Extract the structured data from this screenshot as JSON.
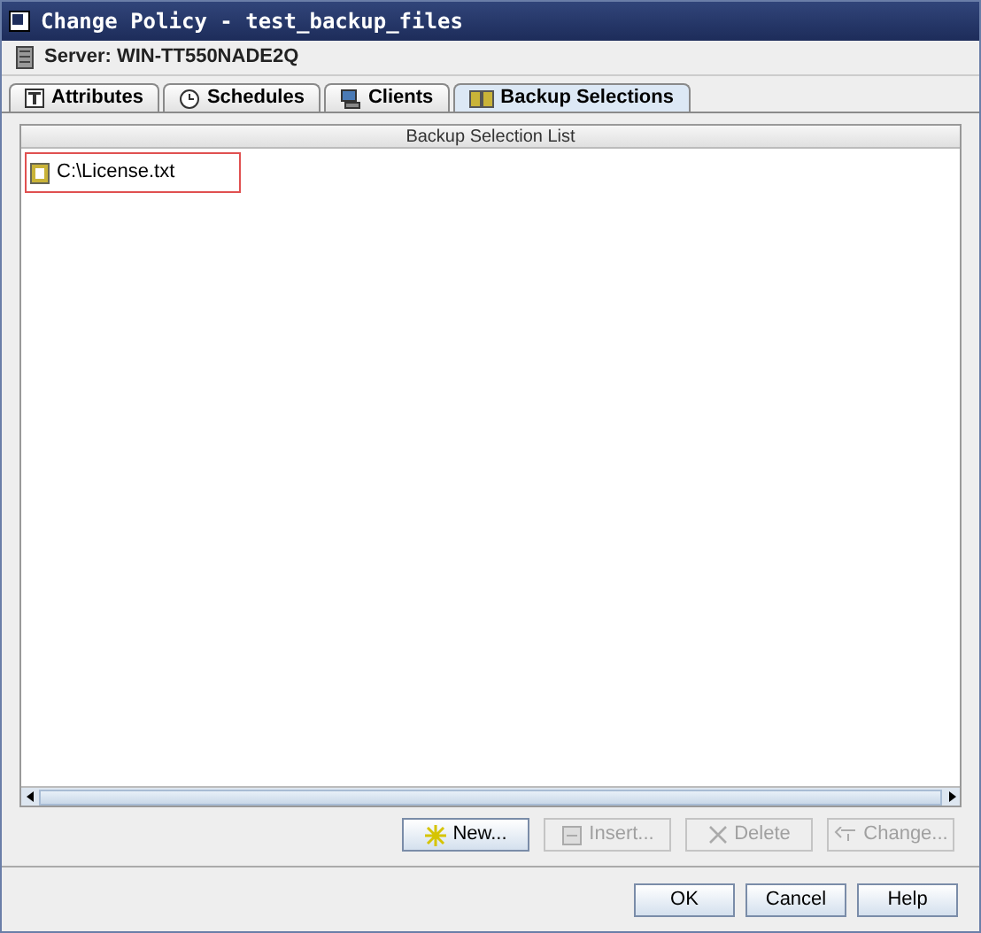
{
  "window": {
    "title": "Change Policy - test_backup_files"
  },
  "server": {
    "label": "Server: WIN-TT550NADE2Q"
  },
  "tabs": [
    {
      "label": "Attributes",
      "kind": "attributes",
      "selected": false
    },
    {
      "label": "Schedules",
      "kind": "schedules",
      "selected": false
    },
    {
      "label": "Clients",
      "kind": "clients",
      "selected": false
    },
    {
      "label": "Backup Selections",
      "kind": "selections",
      "selected": true
    }
  ],
  "list": {
    "heading": "Backup Selection List",
    "items": [
      {
        "label": "C:\\License.txt",
        "highlighted": true
      }
    ]
  },
  "actions": [
    {
      "label": "New...",
      "kind": "new",
      "disabled": false
    },
    {
      "label": "Insert...",
      "kind": "insert",
      "disabled": true
    },
    {
      "label": "Delete",
      "kind": "delete",
      "disabled": true
    },
    {
      "label": "Change...",
      "kind": "change",
      "disabled": true
    }
  ],
  "buttons": [
    {
      "label": "OK"
    },
    {
      "label": "Cancel"
    },
    {
      "label": "Help"
    }
  ]
}
